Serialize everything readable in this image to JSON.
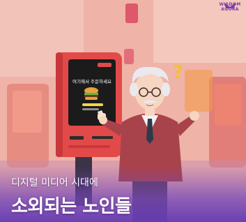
{
  "watermark": {
    "label": "WISDOM AGORA"
  },
  "kiosk": {
    "screen_text": "여기에서 주문하세요"
  },
  "caption": {
    "subtitle": "디지털 미디어 시대에",
    "title": "소외되는 노인들"
  },
  "colors": {
    "kiosk_body": "#e24a4a",
    "kiosk_screen": "#1b1b1b",
    "accent_purple": "#7c3aa8",
    "question_mark": "#f3c12e"
  },
  "icons": {
    "screen_icon": "burger-icon",
    "pointer": "hand-pointer-icon",
    "confusion": "question-mark-icon"
  }
}
